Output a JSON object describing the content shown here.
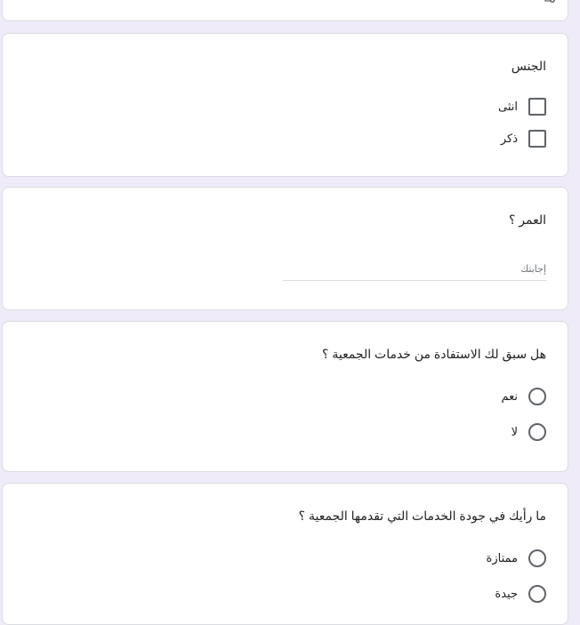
{
  "top_card": {
    "icon": "file-remove-icon"
  },
  "gender_question": {
    "title": "الجنس",
    "options": [
      {
        "label": "انثى"
      },
      {
        "label": "ذكر"
      }
    ]
  },
  "age_question": {
    "title": "العمر ؟",
    "placeholder": "إجابتك"
  },
  "benefit_question": {
    "title": "هل سبق لك الاستفادة من خدمات الجمعية ؟",
    "options": [
      {
        "label": "نعم"
      },
      {
        "label": "لا"
      }
    ]
  },
  "quality_question": {
    "title": "ما رأيك في جودة الخدمات التي تقدمها الجمعية ؟",
    "options": [
      {
        "label": "ممتازة"
      },
      {
        "label": "جيدة"
      }
    ]
  }
}
